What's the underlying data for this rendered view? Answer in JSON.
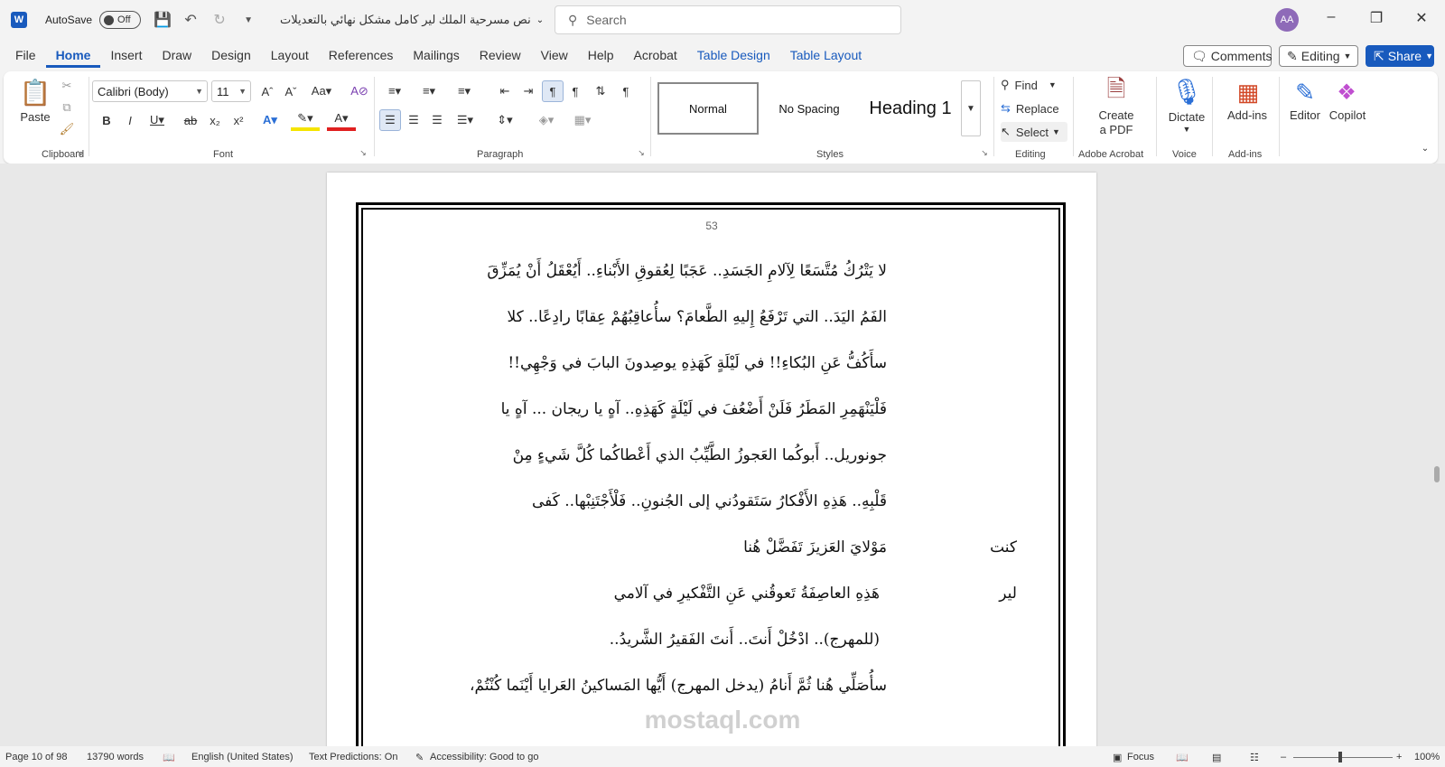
{
  "titlebar": {
    "autosave_label": "AutoSave",
    "autosave_state": "Off",
    "doc_title": "نص مسرحية الملك لير كامل مشكل نهائي بالتعديلات",
    "search_placeholder": "Search",
    "avatar_initials": "AA"
  },
  "menu": {
    "tabs": [
      "File",
      "Home",
      "Insert",
      "Draw",
      "Design",
      "Layout",
      "References",
      "Mailings",
      "Review",
      "View",
      "Help",
      "Acrobat",
      "Table Design",
      "Table Layout"
    ],
    "active_tab": "Home",
    "comments_label": "Comments",
    "editing_label": "Editing",
    "share_label": "Share"
  },
  "ribbon": {
    "clipboard": {
      "paste_label": "Paste",
      "group_label": "Clipboard"
    },
    "font": {
      "font_name": "Calibri (Body)",
      "font_size": "11",
      "group_label": "Font"
    },
    "paragraph": {
      "group_label": "Paragraph"
    },
    "styles": {
      "items": [
        "Normal",
        "No Spacing",
        "Heading 1"
      ],
      "group_label": "Styles"
    },
    "editing": {
      "find_label": "Find",
      "replace_label": "Replace",
      "select_label": "Select",
      "group_label": "Editing"
    },
    "acrobat": {
      "create_pdf_line1": "Create",
      "create_pdf_line2": "a PDF",
      "group_label": "Adobe Acrobat"
    },
    "voice": {
      "dictate_label": "Dictate",
      "group_label": "Voice"
    },
    "addins": {
      "addins_label": "Add-ins",
      "group_label": "Add-ins"
    },
    "editor_label": "Editor",
    "copilot_label": "Copilot"
  },
  "document": {
    "page_number": "53",
    "lines": [
      "لا يَتْرُكُ مُتَّسَعًا لِآلامِ الجَسَدِ.. عَجَبًا لِعُقوقِ الأَبْناءِ.. أَيُعْقَلُ أَنْ يُمَزِّقَ",
      "الفَمُ اليَدَ.. التي تَرْفَعُ إِليهِ الطَّعامَ؟ سأُعاقِبُهُمْ عِقابًا رادِعًا.. كلا",
      "سأَكُفُّ عَنِ البُكاءِ!! في لَيْلَةٍ كَهَذِهِ يوصِدونَ البابَ في وَجْهِي!!",
      "فَلْيَنْهَمِرِ المَطَرُ فَلَنْ أَضْعُفَ في لَيْلَةٍ كَهَذِهِ.. آهٍ يا ريجان ... آهٍ يا",
      "جونوريل.. أَبوكُما العَجوزُ الطَّيِّبُ الذي أَعْطاكُما كُلَّ شَيءٍ مِنْ",
      "قَلْبِهِ.. هَذِهِ الأَفْكارُ سَتَقودُني إلى الجُنونِ.. فَلْأَجْتَنِبْها.. كَفى"
    ],
    "dialog": [
      {
        "speaker": "كنت",
        "text": "مَوْلايَ العَزيزَ تَفَضَّلْ هُنا"
      },
      {
        "speaker": "لير",
        "text": "هَذِهِ العاصِفَةُ تَعوقُني عَنِ التَّفْكيرِ في آلامي"
      }
    ],
    "line_after_1": "(للمهرج).. ادْخُلْ أَنتَ.. أَنتَ الفَقيرُ الشَّريدُ..",
    "line_after_2": "سأُصَلِّي هُنا ثُمَّ أَنامُ (يدخل المهرج) أَيُّها المَساكينُ العَرايا أَيْنَما كُنْتُمْ،",
    "watermark": "mostaql.com"
  },
  "status": {
    "page": "Page 10 of 98",
    "words": "13790 words",
    "language": "English (United States)",
    "predictions": "Text Predictions: On",
    "accessibility": "Accessibility: Good to go",
    "focus": "Focus",
    "zoom": "100%"
  }
}
